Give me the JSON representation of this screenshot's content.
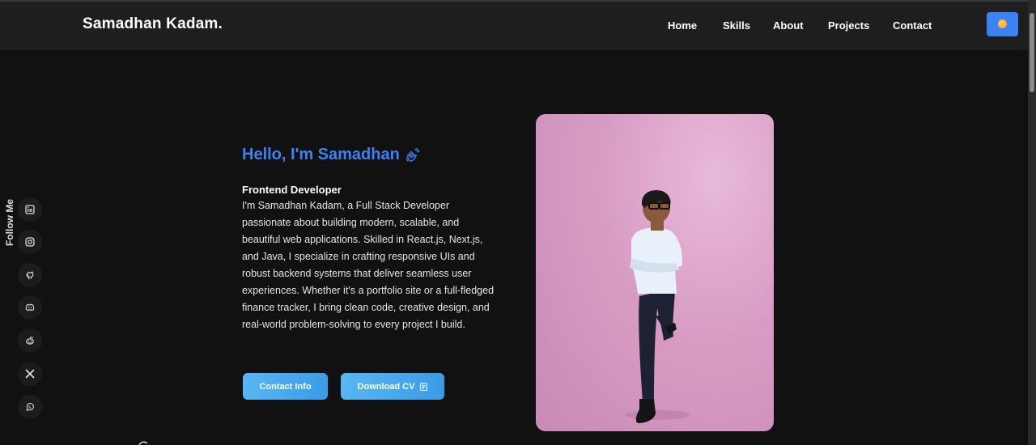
{
  "header": {
    "brand": "Samadhan Kadam.",
    "nav": [
      {
        "label": "Home"
      },
      {
        "label": "Skills"
      },
      {
        "label": "About"
      },
      {
        "label": "Projects"
      },
      {
        "label": "Contact"
      }
    ],
    "theme_toggle_icon": "sun-icon"
  },
  "sidebar": {
    "label": "Follow Me",
    "socials": [
      {
        "icon": "linkedin-icon"
      },
      {
        "icon": "instagram-icon"
      },
      {
        "icon": "github-icon"
      },
      {
        "icon": "discord-icon"
      },
      {
        "icon": "reddit-icon"
      },
      {
        "icon": "x-icon"
      },
      {
        "icon": "whatsapp-icon"
      }
    ]
  },
  "hero": {
    "greeting": "Hello, I'm Samadhan",
    "greeting_icon": "waving-hand-icon",
    "role": "Frontend Developer",
    "bio": "I'm Samadhan Kadam, a Full Stack Developer passionate about building modern, scalable, and beautiful web applications. Skilled in React.js, Next.js, and Java, I specialize in crafting responsive UIs and robust backend systems that deliver seamless user experiences. Whether it’s a portfolio site or a full-fledged finance tracker, I bring clean code, creative design, and real-world problem-solving to every project I build.",
    "contact_button": "Contact Info",
    "cv_button": "Download CV",
    "cv_icon": "document-icon"
  },
  "colors": {
    "accent": "#3b82f6",
    "background": "#111111",
    "navbar": "#1e1e1e",
    "button_gradient_start": "#58b6f2",
    "button_gradient_end": "#3a9ce8",
    "photo_background": "#d89cc4"
  }
}
